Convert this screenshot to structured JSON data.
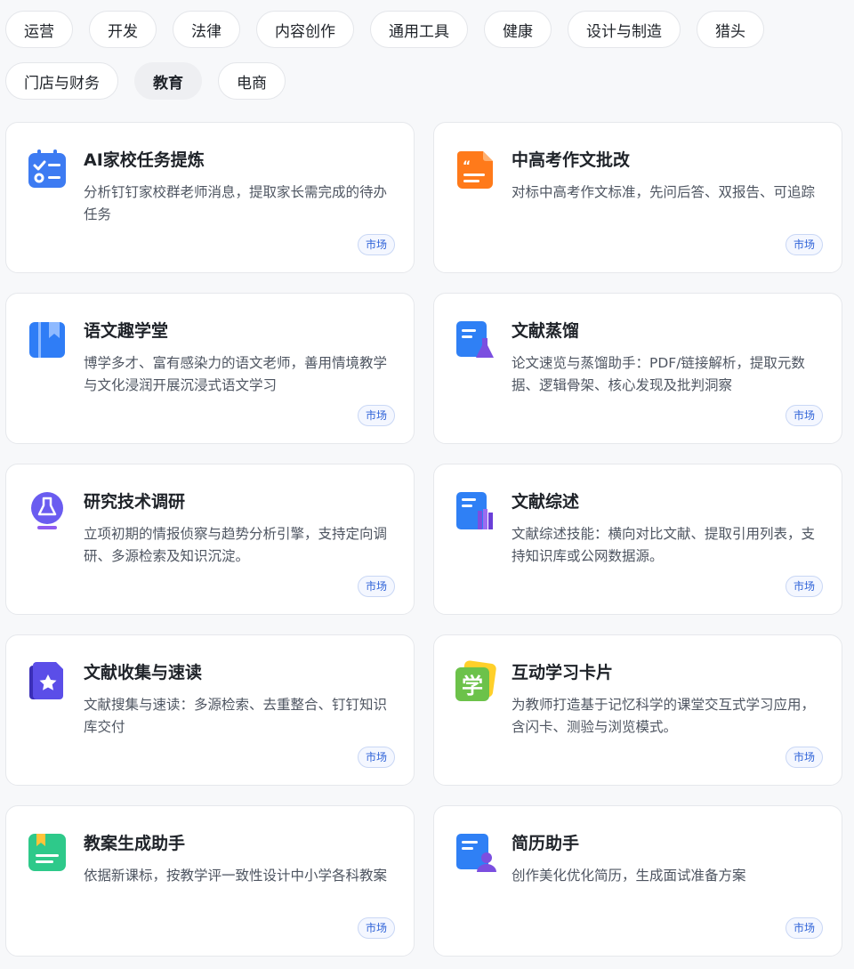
{
  "filters": [
    {
      "label": "运营"
    },
    {
      "label": "开发"
    },
    {
      "label": "法律"
    },
    {
      "label": "内容创作"
    },
    {
      "label": "通用工具"
    },
    {
      "label": "健康"
    },
    {
      "label": "设计与制造"
    },
    {
      "label": "猎头"
    },
    {
      "label": "门店与财务"
    },
    {
      "label": "教育",
      "active": true
    },
    {
      "label": "电商"
    }
  ],
  "cards": [
    {
      "title": "AI家校任务提炼",
      "description": "分析钉钉家校群老师消息，提取家长需完成的待办任务",
      "tag": "市场",
      "icon": "checklist-icon",
      "color": "#3d7bf2"
    },
    {
      "title": "中高考作文批改",
      "description": "对标中高考作文标准，先问后答、双报告、可追踪",
      "tag": "市场",
      "icon": "quote-document-icon",
      "color": "#ff7a1a"
    },
    {
      "title": "语文趣学堂",
      "description": "博学多才、富有感染力的语文老师，善用情境教学与文化浸润开展沉浸式语文学习",
      "tag": "市场",
      "icon": "bookmark-book-icon",
      "color": "#2f7df6"
    },
    {
      "title": "文献蒸馏",
      "description": "论文速览与蒸馏助手：PDF/链接解析，提取元数据、逻辑骨架、核心发现及批判洞察",
      "tag": "市场",
      "icon": "document-flask-icon",
      "color": "#2f80f5"
    },
    {
      "title": "研究技术调研",
      "description": "立项初期的情报侦察与趋势分析引擎，支持定向调研、多源检索及知识沉淀。",
      "tag": "市场",
      "icon": "flask-badge-icon",
      "color": "#6a5cf0"
    },
    {
      "title": "文献综述",
      "description": "文献综述技能：横向对比文献、提取引用列表，支持知识库或公网数据源。",
      "tag": "市场",
      "icon": "document-books-icon",
      "color": "#2f80f5"
    },
    {
      "title": "文献收集与速读",
      "description": "文献搜集与速读：多源检索、去重整合、钉钉知识库交付",
      "tag": "市场",
      "icon": "star-document-icon",
      "color": "#5b4ee8"
    },
    {
      "title": "互动学习卡片",
      "description": "为教师打造基于记忆科学的课堂交互式学习应用，含闪卡、测验与浏览模式。",
      "tag": "市场",
      "icon": "study-card-icon",
      "color": "#6cc24a",
      "glyph": "学"
    },
    {
      "title": "教案生成助手",
      "description": "依据新课标，按教学评一致性设计中小学各科教案",
      "tag": "市场",
      "icon": "lesson-plan-icon",
      "color": "#2ec98a"
    },
    {
      "title": "简历助手",
      "description": "创作美化优化简历，生成面试准备方案",
      "tag": "市场",
      "icon": "resume-person-icon",
      "color": "#2f80f5"
    }
  ]
}
